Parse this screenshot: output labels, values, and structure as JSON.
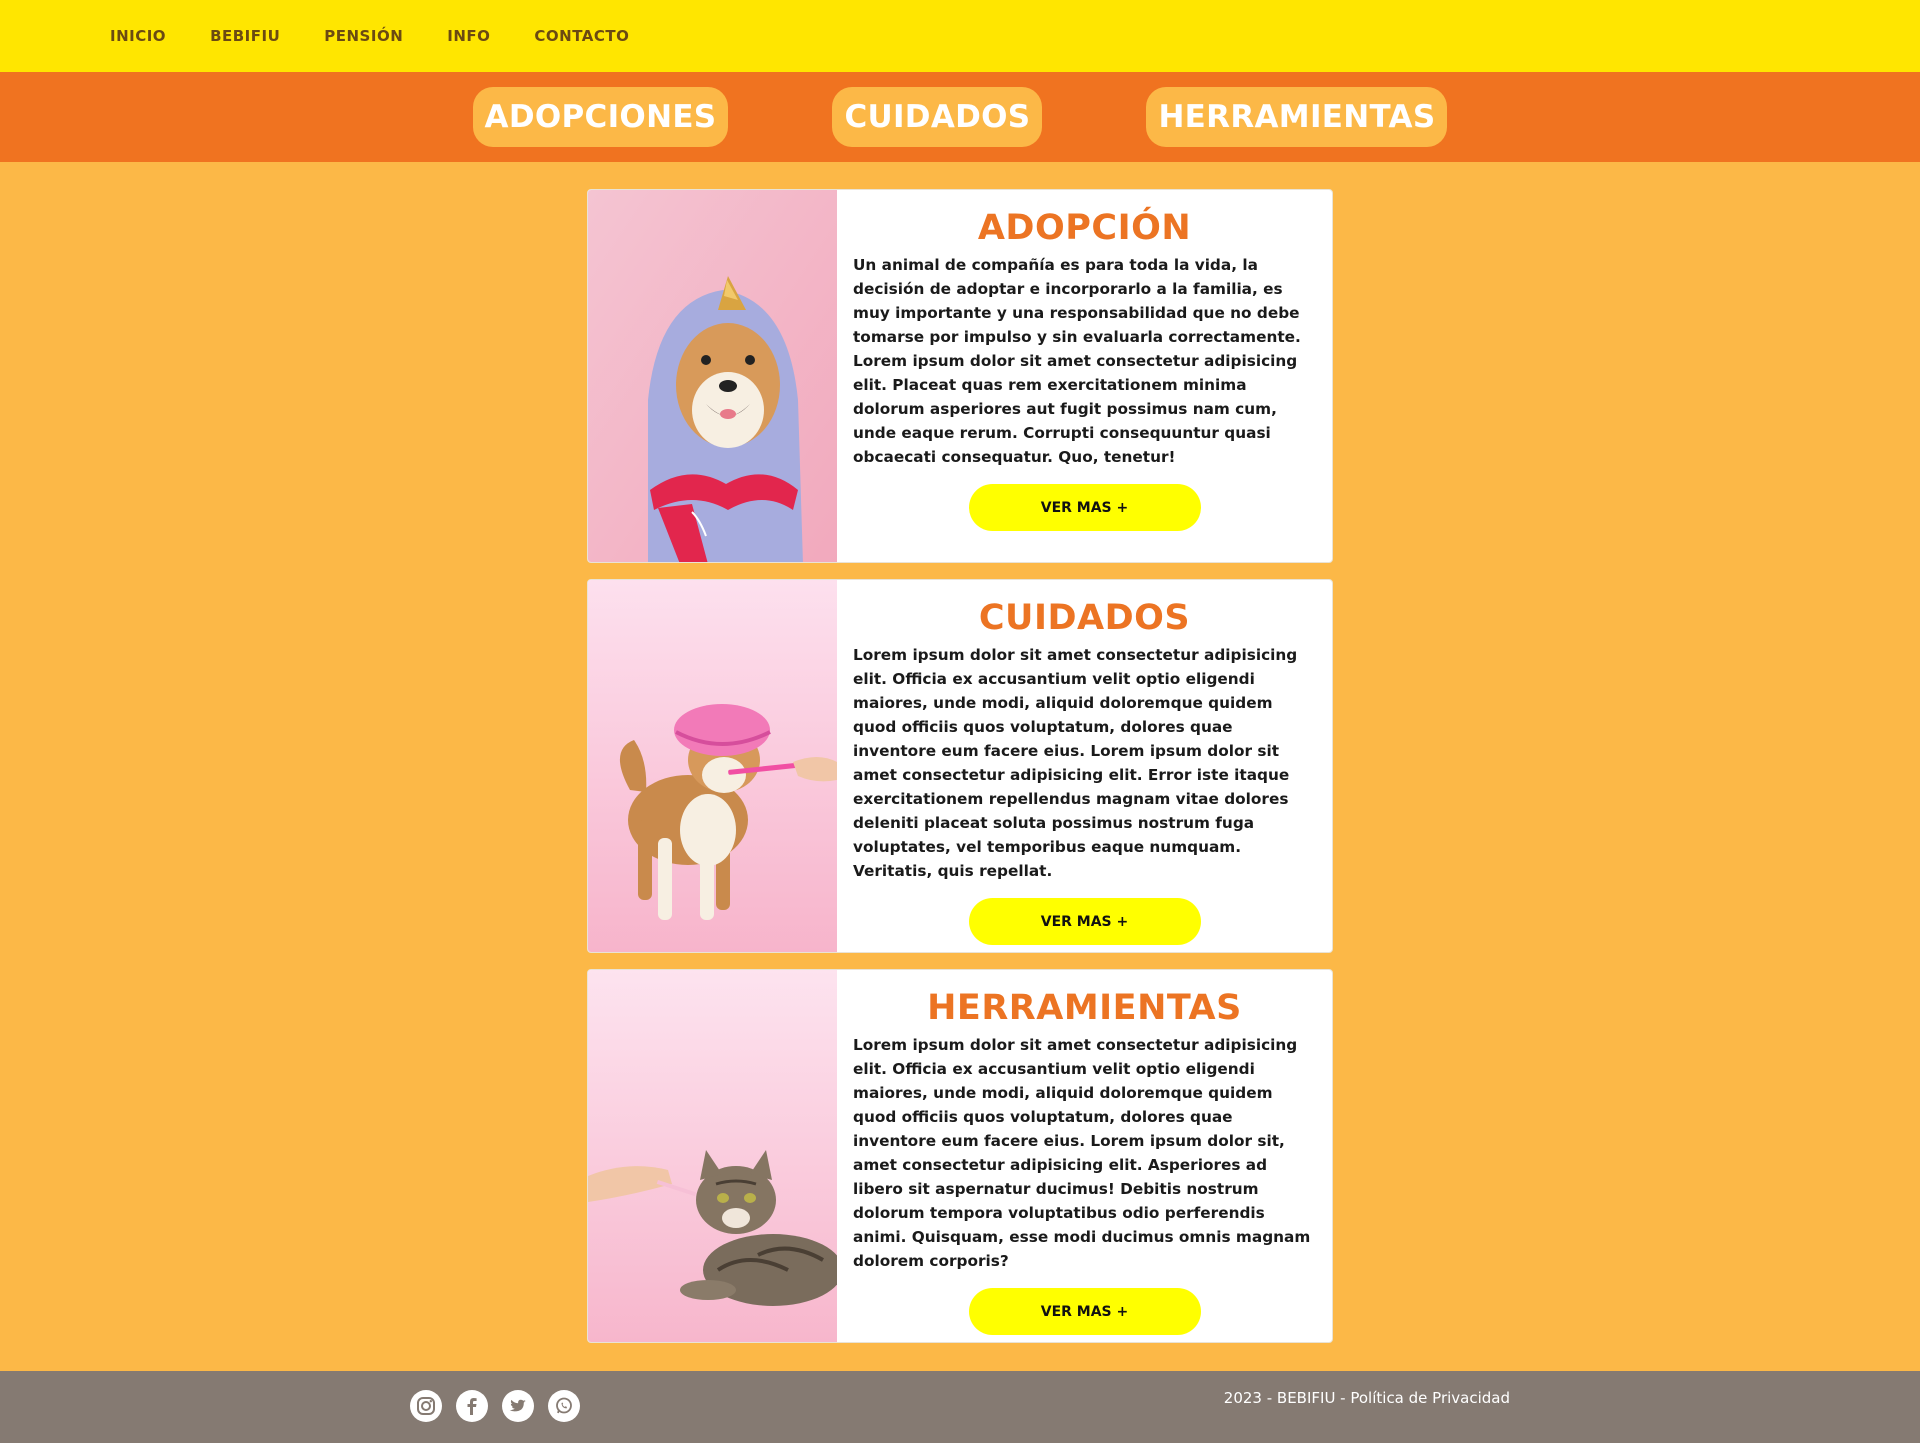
{
  "topnav": {
    "items": [
      {
        "label": "INICIO"
      },
      {
        "label": "BEBIFIU"
      },
      {
        "label": "PENSIÓN"
      },
      {
        "label": "INFO"
      },
      {
        "label": "CONTACTO"
      }
    ]
  },
  "subnav": {
    "items": [
      {
        "label": "ADOPCIONES"
      },
      {
        "label": "CUIDADOS"
      },
      {
        "label": "HERRAMIENTAS"
      }
    ]
  },
  "cards": [
    {
      "title": "ADOPCIÓN",
      "text": "Un animal de compañía es para toda la vida, la decisión de adoptar e incorporarlo a la familia, es muy importante y una responsabilidad que no debe tomarse por impulso y sin evaluarla correctamente. Lorem ipsum dolor sit amet consectetur adipisicing elit. Placeat quas rem exercitationem minima dolorum asperiores aut fugit possimus nam cum, unde eaque rerum. Corrupti consequuntur quasi obcaecati consequatur. Quo, tenetur!",
      "button": "VER MAS +",
      "image_icon": "shiba-dog-unicorn-costume-photo"
    },
    {
      "title": "CUIDADOS",
      "text": "Lorem ipsum dolor sit amet consectetur adipisicing elit. Officia ex accusantium velit optio eligendi maiores, unde modi, aliquid doloremque quidem quod officiis quos voluptatum, dolores quae inventore eum facere eius. Lorem ipsum dolor sit amet consectetur adipisicing elit. Error iste itaque exercitationem repellendus magnam vitae dolores deleniti placeat soluta possimus nostrum fuga voluptates, vel temporibus eaque numquam. Veritatis, quis repellat.",
      "button": "VER MAS +",
      "image_icon": "shiba-dog-toothbrush-photo"
    },
    {
      "title": "HERRAMIENTAS",
      "text": "Lorem ipsum dolor sit amet consectetur adipisicing elit. Officia ex accusantium velit optio eligendi maiores, unde modi, aliquid doloremque quidem quod officiis quos voluptatum, dolores quae inventore eum facere eius. Lorem ipsum dolor sit, amet consectetur adipisicing elit. Asperiores ad libero sit aspernatur ducimus! Debitis nostrum dolorum tempora voluptatibus odio perferendis animi. Quisquam, esse modi ducimus omnis magnam dolorem corporis?",
      "button": "VER MAS +",
      "image_icon": "tabby-cat-brushing-photo"
    }
  ],
  "footer": {
    "social_icons": [
      "instagram-icon",
      "facebook-icon",
      "twitter-icon",
      "whatsapp-icon"
    ],
    "copyright": "2023 - BEBIFIU - Política de Privacidad"
  },
  "colors": {
    "topnav_bg": "#ffe600",
    "subnav_bg": "#f07320",
    "page_bg": "#fcb847",
    "title_orange": "#ec7423",
    "button_yellow": "#ffff00",
    "footer_bg": "#857a72"
  }
}
